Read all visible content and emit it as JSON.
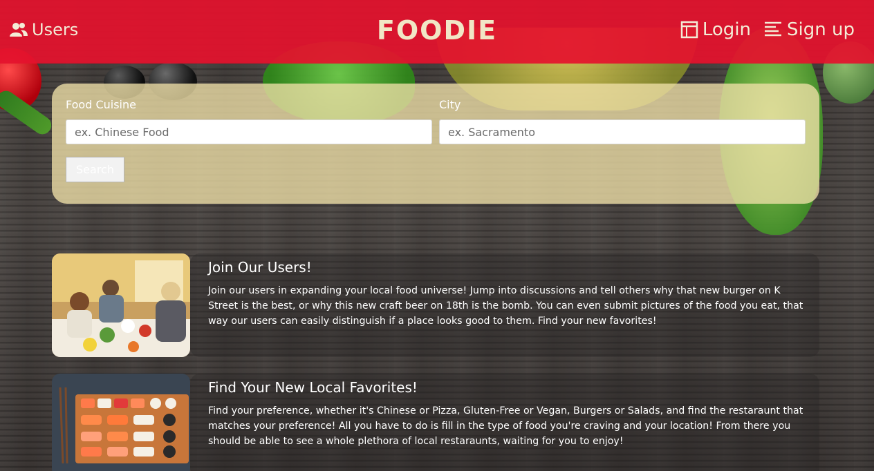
{
  "navbar": {
    "users_label": "Users",
    "brand": "FOODIE",
    "login_label": "Login",
    "signup_label": "Sign up"
  },
  "search": {
    "cuisine_label": "Food Cuisine",
    "cuisine_placeholder": "ex. Chinese Food",
    "city_label": "City",
    "city_placeholder": "ex. Sacramento",
    "button_label": "Search"
  },
  "cards": [
    {
      "title": "Join Our Users!",
      "text": "Join our users in expanding your local food universe! Jump into discussions and tell others why that new burger on K Street is the best, or why this new craft beer on 18th is the bomb. You can even submit pictures of the food you eat, that way our users can easily distinguish if a place looks good to them. Find your new favorites!",
      "image": "family-dinner-photo"
    },
    {
      "title": "Find Your New Local Favorites!",
      "text": "Find your preference, whether it's Chinese or Pizza, Gluten-Free or Vegan, Burgers or Salads, and find the restaraunt that matches your preference! All you have to do is fill in the type of food you're craving and your location! From there you should be able to see a whole plethora of local restaraunts, waiting for you to enjoy!",
      "image": "sushi-platter-photo"
    }
  ],
  "colors": {
    "navbar": "#e4122d",
    "brand_text": "#f1e7c6",
    "panel": "#f0e0a8"
  }
}
